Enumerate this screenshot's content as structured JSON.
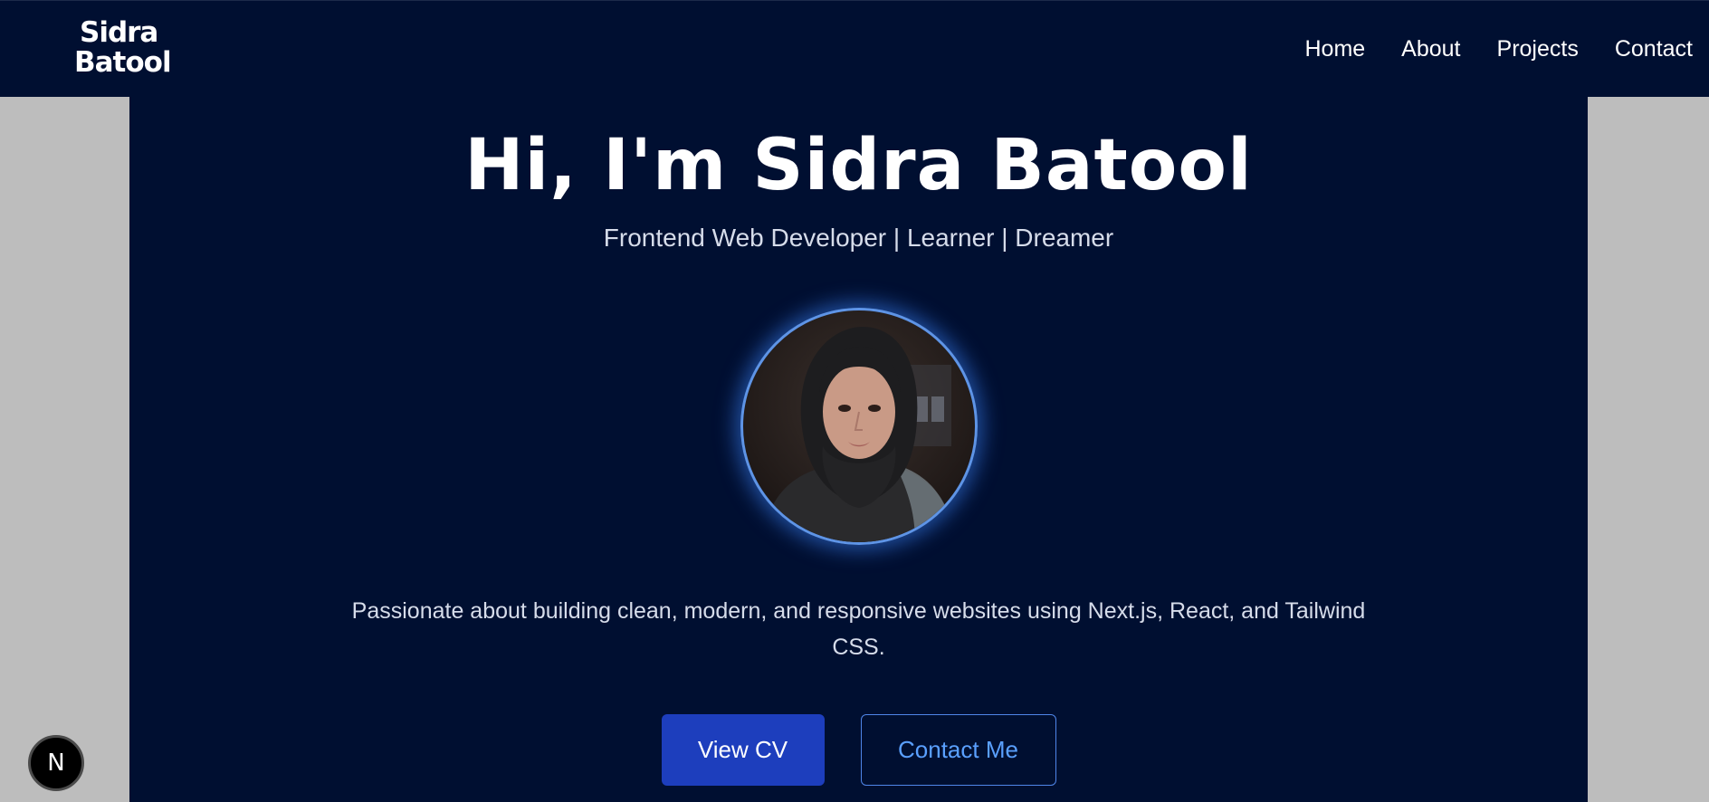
{
  "navbar": {
    "logo": {
      "line1": "Sidra",
      "line2": "Batool"
    },
    "links": [
      {
        "label": "Home"
      },
      {
        "label": "About"
      },
      {
        "label": "Projects"
      },
      {
        "label": "Contact"
      }
    ]
  },
  "hero": {
    "title": "Hi, I'm Sidra Batool",
    "subtitle": "Frontend Web Developer | Learner | Dreamer",
    "description": "Passionate about building clean, modern, and responsive websites using Next.js, React, and Tailwind CSS.",
    "buttons": {
      "primary_label": "View CV",
      "secondary_label": "Contact Me"
    }
  },
  "dev_indicator": {
    "label": "N"
  },
  "colors": {
    "page_background": "#bdbdbd",
    "navy": "#000f31",
    "primary_button": "#1d3ebd",
    "accent_blue": "#5aa0ff",
    "avatar_ring": "#5e94e6"
  }
}
